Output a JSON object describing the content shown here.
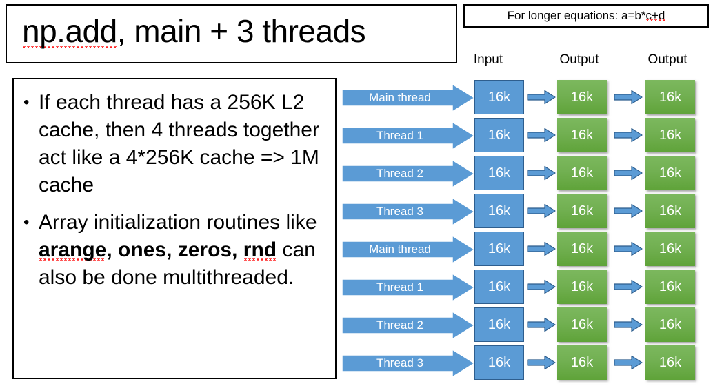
{
  "slide": {
    "title": "np.add, main + 3 threads",
    "title_misspelled_prefix": "np.add",
    "title_rest": ", main + 3 threads",
    "equation_note": "For longer equations: a=b*c+d",
    "equation_note_prefix": "For longer equations: a=b*",
    "equation_note_misspelled": "c+d"
  },
  "bullets": [
    {
      "marker": "•",
      "text": "If each thread has a 256K L2 cache, then 4 threads together act like a 4*256K cache => 1M cache"
    },
    {
      "marker": "•",
      "lead": "Array initialization routines like ",
      "bold": "arange, ones, zeros, rnd",
      "tail": " can also be done multithreaded.",
      "bold_part_1": "arange",
      "bold_part_2": ", ones, zeros, ",
      "bold_part_3": "rnd"
    }
  ],
  "diagram": {
    "headers": [
      {
        "label": "Input"
      },
      {
        "label": "Output"
      },
      {
        "label": "Output"
      }
    ],
    "cell_label": "16k",
    "groups": [
      {
        "rows": [
          {
            "thread": "Main thread",
            "input": "16k",
            "output1": "16k",
            "output2": "16k"
          },
          {
            "thread": "Thread 1",
            "input": "16k",
            "output1": "16k",
            "output2": "16k"
          },
          {
            "thread": "Thread 2",
            "input": "16k",
            "output1": "16k",
            "output2": "16k"
          },
          {
            "thread": "Thread 3",
            "input": "16k",
            "output1": "16k",
            "output2": "16k"
          }
        ]
      },
      {
        "rows": [
          {
            "thread": "Main thread",
            "input": "16k",
            "output1": "16k",
            "output2": "16k"
          },
          {
            "thread": "Thread 1",
            "input": "16k",
            "output1": "16k",
            "output2": "16k"
          },
          {
            "thread": "Thread 2",
            "input": "16k",
            "output1": "16k",
            "output2": "16k"
          },
          {
            "thread": "Thread 3",
            "input": "16k",
            "output1": "16k",
            "output2": "16k"
          }
        ]
      }
    ]
  },
  "colors": {
    "blue": "#5B9BD5",
    "blue_border": "#2E5E8E",
    "green_light": "#7CB85E",
    "green_dark": "#5FA339",
    "spellcheck_red": "#ff2020",
    "text": "#000000",
    "background": "#ffffff"
  }
}
